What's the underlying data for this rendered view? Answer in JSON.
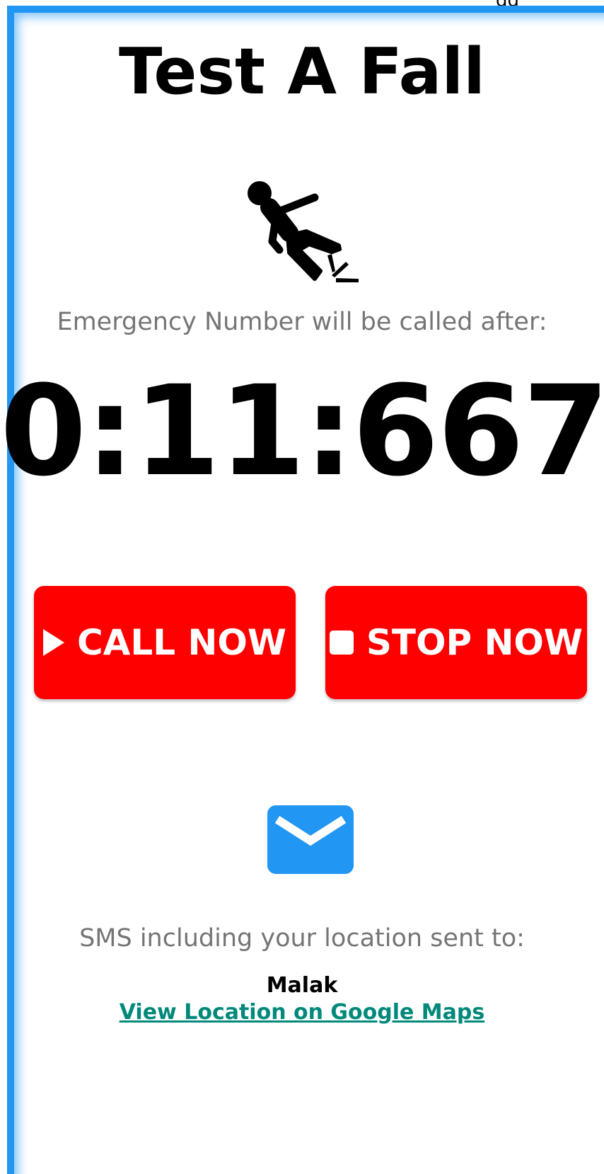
{
  "top_strip": {
    "text": "gg"
  },
  "screen": {
    "title": "Test A Fall",
    "fall_icon": "person-falling-icon",
    "countdown_label": "Emergency Number will be called after:",
    "countdown_value": "0:11:667"
  },
  "buttons": {
    "call": {
      "label": "CALL NOW",
      "icon": "play-icon"
    },
    "stop": {
      "label": "STOP NOW",
      "icon": "stop-icon"
    }
  },
  "sms": {
    "icon": "mail-icon",
    "message": "SMS including your location sent to:",
    "contact_name": "Malak",
    "maps_link_label": "View Location on Google Maps"
  },
  "colors": {
    "frame_accent": "#2196F3",
    "button_red": "#FF0000",
    "mail_blue": "#2196F3",
    "link_teal": "#00897B",
    "secondary_text": "#757575"
  }
}
